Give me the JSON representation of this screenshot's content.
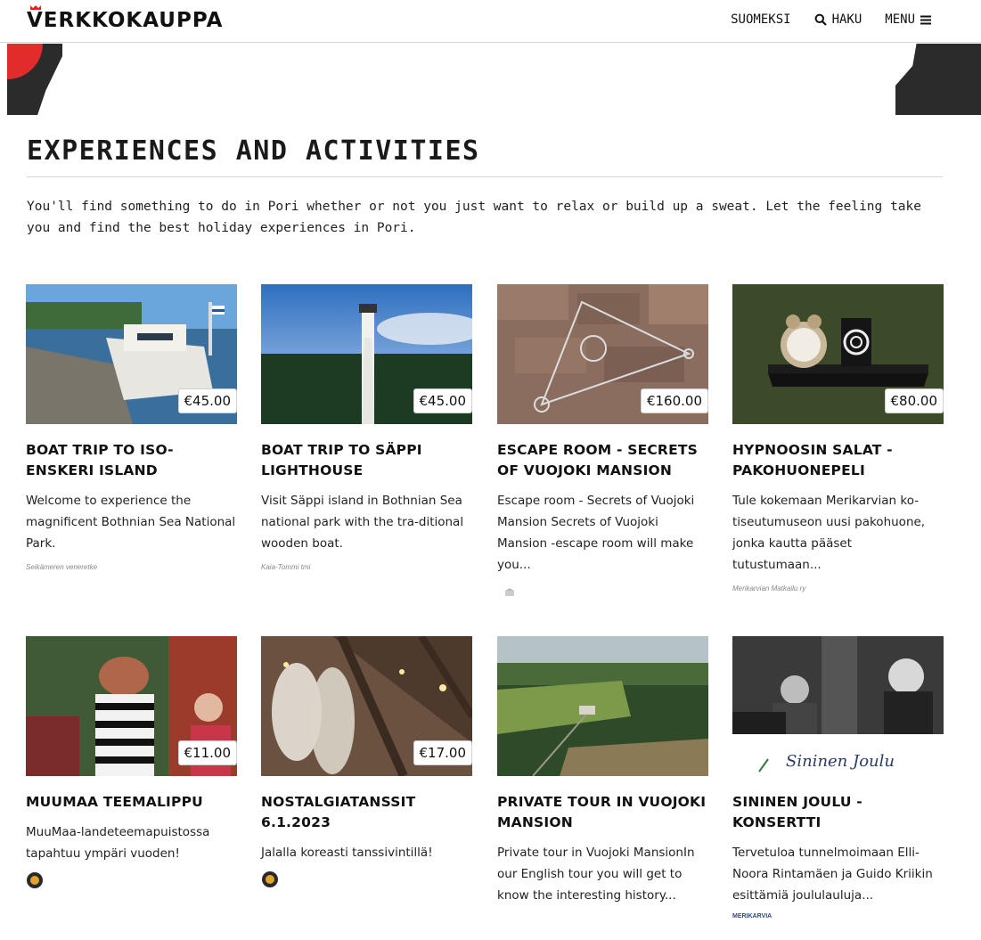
{
  "header": {
    "logo": "VERKKOKAUPPA",
    "nav": {
      "language": "SUOMEKSI",
      "search": "HAKU",
      "menu": "MENU"
    }
  },
  "page": {
    "title": "EXPERIENCES AND ACTIVITIES",
    "intro": "You'll find something to do in Pori whether or not you just want to relax or build up a sweat. Let the feeling take you and find the best holiday experiences in Pori."
  },
  "cards": [
    {
      "price": "€45.00",
      "title": "BOAT TRIP TO ISO-ENSKERI ISLAND",
      "description": "Welcome to experience the magnificent Bothnian Sea National Park.",
      "organizer": "Seikämeren veneretke"
    },
    {
      "price": "€45.00",
      "title": "BOAT TRIP TO SÄPPI LIGHTHOUSE",
      "description": "Visit Säppi island in Bothnian Sea national park with the tra-ditional wooden boat.",
      "organizer": "Kaia-Tommi tmi"
    },
    {
      "price": "€160.00",
      "title": "ESCAPE ROOM - SECRETS OF VUOJOKI MANSION",
      "description": "Escape room - Secrets of Vuojoki Mansion Secrets of Vuojoki Mansion -escape room will make you...",
      "organizer": ""
    },
    {
      "price": "€80.00",
      "title": "HYPNOOSIN SALAT - PAKOHUONEPELI",
      "description": "Tule kokemaan Merikarvian ko-tiseutumuseon uusi pakohuone, jonka kautta pääset tutustumaan...",
      "organizer": "Merikarvian Matkailu ry"
    },
    {
      "price": "€11.00",
      "title": "MUUMAA TEEMALIPPU",
      "description": "MuuMaa-landeteemapuistossa tapahtuu ympäri vuoden!",
      "organizer": ""
    },
    {
      "price": "€17.00",
      "title": "NOSTALGIATANSSIT 6.1.2023",
      "description": "Jalalla koreasti tanssivintillä!",
      "organizer": ""
    },
    {
      "price": "",
      "title": "PRIVATE TOUR IN VUOJOKI MANSION",
      "description": "Private tour in Vuojoki MansionIn our English tour you will get to know the interesting history...",
      "organizer": ""
    },
    {
      "price": "",
      "title": "SININEN JOULU - KONSERTTI",
      "description": "Tervetuloa tunnelmoimaan Elli-Noora Rintamäen ja Guido Kriikin esittämiä joululauluja...",
      "organizer": "MERIKARVIA",
      "image_caption": "Sininen Joulu"
    }
  ],
  "colors": {
    "accent_red": "#e2231a",
    "text": "#1a1a1a",
    "rule": "#d6d6d6"
  }
}
